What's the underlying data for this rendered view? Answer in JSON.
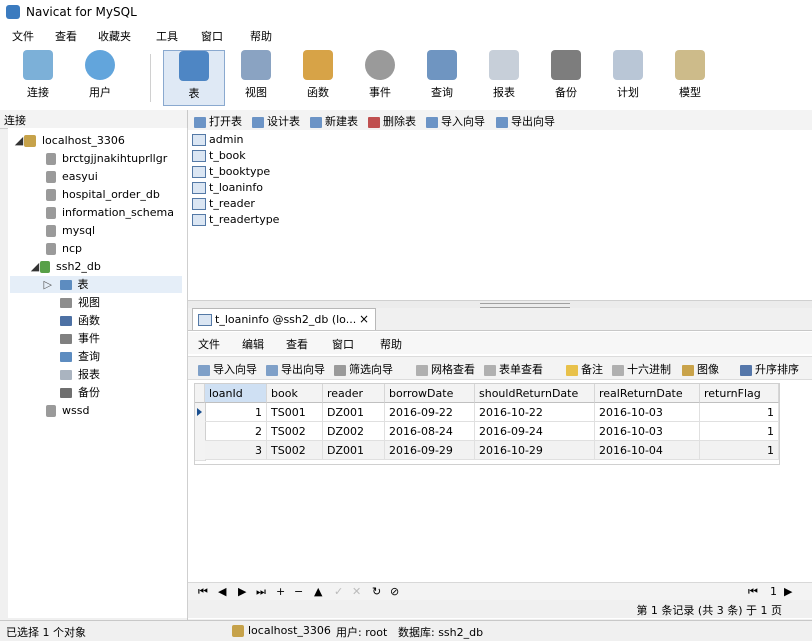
{
  "window": {
    "title": "Navicat for MySQL"
  },
  "menu": [
    "文件",
    "查看",
    "收藏夹",
    "工具",
    "窗口",
    "帮助"
  ],
  "toolbar": {
    "buttons": [
      {
        "label": "连接",
        "icon": "connect-icon"
      },
      {
        "label": "用户",
        "icon": "user-icon"
      },
      {
        "label": "表",
        "icon": "table-icon",
        "active": true
      },
      {
        "label": "视图",
        "icon": "view-icon"
      },
      {
        "label": "函数",
        "icon": "function-icon"
      },
      {
        "label": "事件",
        "icon": "event-icon"
      },
      {
        "label": "查询",
        "icon": "query-icon"
      },
      {
        "label": "报表",
        "icon": "report-icon"
      },
      {
        "label": "备份",
        "icon": "backup-icon"
      },
      {
        "label": "计划",
        "icon": "schedule-icon"
      },
      {
        "label": "模型",
        "icon": "model-icon"
      }
    ]
  },
  "connections": {
    "header": "连接",
    "host": "localhost_3306",
    "databases": [
      "brctgjjnakihtuprllgr",
      "easyui",
      "hospital_order_db",
      "information_schema",
      "mysql",
      "ncp",
      "ssh2_db"
    ],
    "open_db_children": [
      "表",
      "视图",
      "函数",
      "事件",
      "查询",
      "报表",
      "备份"
    ],
    "after": "wssd"
  },
  "object_toolbar": [
    "打开表",
    "设计表",
    "新建表",
    "删除表",
    "导入向导",
    "导出向导"
  ],
  "tables": [
    "admin",
    "t_book",
    "t_booktype",
    "t_loaninfo",
    "t_reader",
    "t_readertype"
  ],
  "doc_tab": {
    "title": "t_loaninfo @ssh2_db (lo...",
    "close": "×"
  },
  "inner_menu": [
    "文件",
    "编辑",
    "查看",
    "窗口",
    "帮助"
  ],
  "inner_toolbar": [
    "导入向导",
    "导出向导",
    "筛选向导",
    "网格查看",
    "表单查看",
    "备注",
    "十六进制",
    "图像",
    "升序排序"
  ],
  "grid": {
    "columns": [
      "loanId",
      "book",
      "reader",
      "borrowDate",
      "shouldReturnDate",
      "realReturnDate",
      "returnFlag"
    ],
    "rows": [
      [
        "1",
        "TS001",
        "DZ001",
        "2016-09-22",
        "2016-10-22",
        "2016-10-03",
        "1"
      ],
      [
        "2",
        "TS002",
        "DZ002",
        "2016-08-24",
        "2016-09-24",
        "2016-10-03",
        "1"
      ],
      [
        "3",
        "TS002",
        "DZ001",
        "2016-09-29",
        "2016-10-29",
        "2016-10-04",
        "1"
      ]
    ]
  },
  "navbar": {
    "buttons": [
      "⏮",
      "◀",
      "▶",
      "⏭",
      "+",
      "−",
      "▲",
      "✓",
      "✕",
      "↻",
      "⊘"
    ],
    "page": "1"
  },
  "record_info": "第 1 条记录 (共 3 条) 于 1 页",
  "status": {
    "selected": "已选择 1 个对象",
    "host": "localhost_3306",
    "user": "用户: root",
    "db": "数据库: ssh2_db"
  },
  "colors": {
    "accent": "#3b7bbf",
    "active_db": "#58a048"
  }
}
